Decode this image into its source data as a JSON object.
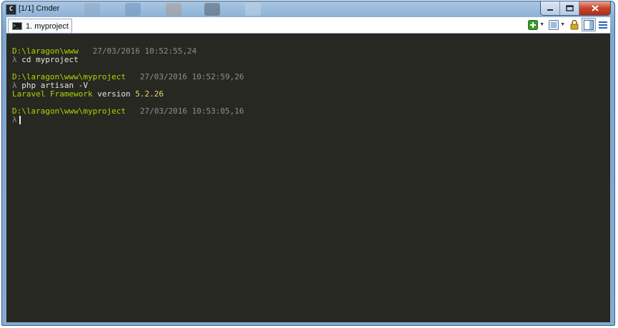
{
  "window": {
    "title": "[1/1] Cmder",
    "app_icon_glyph": "C",
    "controls": [
      "minimize-icon",
      "maximize-icon",
      "close-icon"
    ]
  },
  "tabs": [
    {
      "label": "1. myproject",
      "icon": "console-icon",
      "active": true
    }
  ],
  "toolbar": {
    "icons": [
      "new-console-icon",
      "split-icon",
      "lock-icon",
      "panel-icon",
      "menu-icon"
    ],
    "colors": {
      "new_console": "#3a9b2c",
      "lock": "#d9a520",
      "menu": "#2b62b8"
    }
  },
  "console": {
    "background": "#272822",
    "lines": [
      {
        "path": "D:\\laragon\\www",
        "timestamp": "27/03/2016 10:52:55,24"
      },
      {
        "prompt": "λ",
        "command": "cd myproject"
      },
      {
        "path": "D:\\laragon\\www\\myproject",
        "timestamp": "27/03/2016 10:52:59,26"
      },
      {
        "prompt": "λ",
        "command": "php artisan -V"
      },
      {
        "output_a": "Laravel Framework",
        "output_b": "version",
        "output_c": "5.2.26"
      },
      {
        "path": "D:\\laragon\\www\\myproject",
        "timestamp": "27/03/2016 10:53:05,16"
      },
      {
        "prompt": "λ",
        "command": ""
      }
    ]
  }
}
